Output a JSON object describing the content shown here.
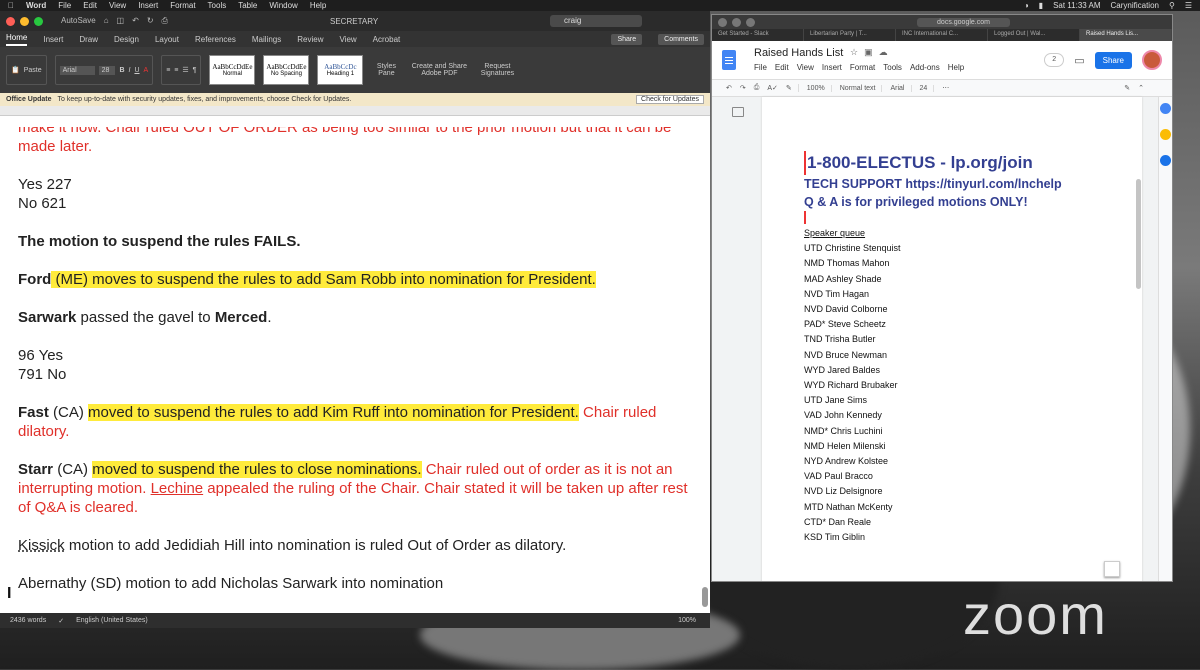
{
  "menubar": {
    "apple": "",
    "app": "Word",
    "items": [
      "File",
      "Edit",
      "View",
      "Insert",
      "Format",
      "Tools",
      "Table",
      "Window",
      "Help"
    ],
    "clock": "Sat 11:33 AM",
    "user": "Carynification"
  },
  "word": {
    "autosave": "AutoSave",
    "doc_title": "SECRETARY",
    "search_value": "craig",
    "tabs": [
      "Home",
      "Insert",
      "Draw",
      "Design",
      "Layout",
      "References",
      "Mailings",
      "Review",
      "View",
      "Acrobat"
    ],
    "share": "Share",
    "comments": "Comments",
    "font": "Arial",
    "size": "28",
    "paste": "Paste",
    "styles": [
      {
        "sample": "AaBbCcDdEe",
        "name": "Normal"
      },
      {
        "sample": "AaBbCcDdEe",
        "name": "No Spacing"
      },
      {
        "sample": "AaBbCcDc",
        "name": "Heading 1"
      }
    ],
    "styles_pane": "Styles Pane",
    "create_pdf": "Create and Share Adobe PDF",
    "request_sig": "Request Signatures",
    "update_bar": {
      "title": "Office Update",
      "text": "To keep up-to-date with security updates, fixes, and improvements, choose Check for Updates.",
      "button": "Check for Updates"
    },
    "doc": {
      "p0": "make it now.  Chair ruled OUT OF ORDER as being too similar to the prior motion but that it can be made later.",
      "p1a": "Yes 227",
      "p1b": "No 621",
      "p2": "The motion to suspend the rules FAILS.",
      "p3_name": "Ford",
      "p3_text": " (ME) moves to suspend the rules to add Sam Robb into nomination for President.",
      "p4_name": "Sarwark",
      "p4_mid": " passed the gavel to ",
      "p4_name2": "Merced",
      "p4_end": ".",
      "p5a": "96 Yes",
      "p5b": "791 No",
      "p6_name": "Fast",
      "p6_state": " (CA) ",
      "p6_hl": "moved to suspend the rules to add Kim Ruff into nomination for President.",
      "p6_red": "  Chair ruled dilatory.",
      "p7_name": "Starr",
      "p7_state": " (CA) ",
      "p7_hl": "moved to suspend the rules to close nominations.",
      "p7_red1": "  Chair ruled out of order as it is not an interrupting motion.  ",
      "p7_lechine": "Lechine",
      "p7_red2": " appealed the ruling of the Chair.  Chair stated it will be taken up after rest of Q&A is cleared.",
      "p8_name": "Kissick",
      "p8_text": " motion to add Jedidiah Hill into nomination is ruled Out of Order as dilatory.",
      "p9": "Abernathy (SD) motion to add Nicholas Sarwark into nomination"
    },
    "status": {
      "words": "2436 words",
      "lang": "English (United States)",
      "zoom": "100%"
    }
  },
  "browser": {
    "url": "docs.google.com",
    "tabs": [
      "Get Started - Slack",
      "Libertarian Party | T...",
      "INC International C...",
      "Logged Out | Wal...",
      "Raised Hands Lis..."
    ]
  },
  "gdocs": {
    "title": "Raised Hands List",
    "menu": [
      "File",
      "Edit",
      "View",
      "Insert",
      "Format",
      "Tools",
      "Add-ons",
      "Help"
    ],
    "share": "Share",
    "viewers": "2",
    "zoom": "100%",
    "style": "Normal text",
    "font": "Arial",
    "size": "24",
    "heading1": "1-800-ELECTUS - lp.org/join",
    "heading2": "TECH SUPPORT https://tinyurl.com/lnchelp",
    "heading3": "Q & A is for privileged motions ONLY!",
    "queue_label": "Speaker queue",
    "queue": [
      "UTD Christine Stenquist",
      "NMD Thomas Mahon",
      "MAD Ashley Shade",
      "NVD Tim Hagan",
      "NVD David Colborne",
      "PAD* Steve Scheetz",
      "TND Trisha Butler",
      "NVD Bruce Newman",
      "WYD Jared Baldes",
      "WYD Richard Brubaker",
      "UTD Jane Sims",
      "VAD John Kennedy",
      "NMD* Chris Luchini",
      "NMD Helen Milenski",
      "NYD Andrew Kolstee",
      "VAD Paul Bracco",
      "NVD Liz Delsignore",
      "MTD Nathan McKenty",
      "CTD* Dan Reale",
      "KSD Tim Giblin"
    ]
  },
  "overlay": {
    "zoom_logo": "zoom"
  }
}
